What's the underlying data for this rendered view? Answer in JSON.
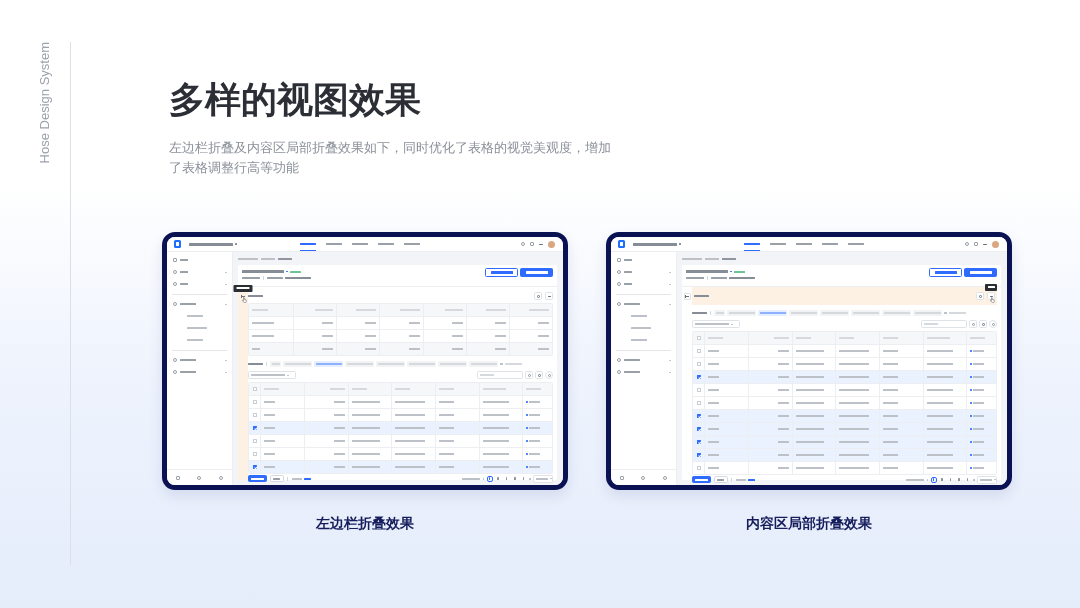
{
  "side_label": "Hose Design System",
  "title": "多样的视图效果",
  "description": "左边栏折叠及内容区局部折叠效果如下，同时优化了表格的视觉美观度，增加了表格调整行高等功能",
  "previews": [
    {
      "caption": "左边栏折叠效果",
      "kind": "sidebar",
      "rows": [
        {
          "checked": false
        },
        {
          "checked": false
        },
        {
          "checked": true
        },
        {
          "checked": false
        },
        {
          "checked": false
        },
        {
          "checked": true
        }
      ]
    },
    {
      "caption": "内容区局部折叠效果",
      "kind": "section",
      "rows": [
        {
          "checked": false
        },
        {
          "checked": false
        },
        {
          "checked": true
        },
        {
          "checked": false
        },
        {
          "checked": false
        },
        {
          "checked": true
        },
        {
          "checked": true
        },
        {
          "checked": true
        },
        {
          "checked": true
        },
        {
          "checked": false
        }
      ]
    }
  ]
}
